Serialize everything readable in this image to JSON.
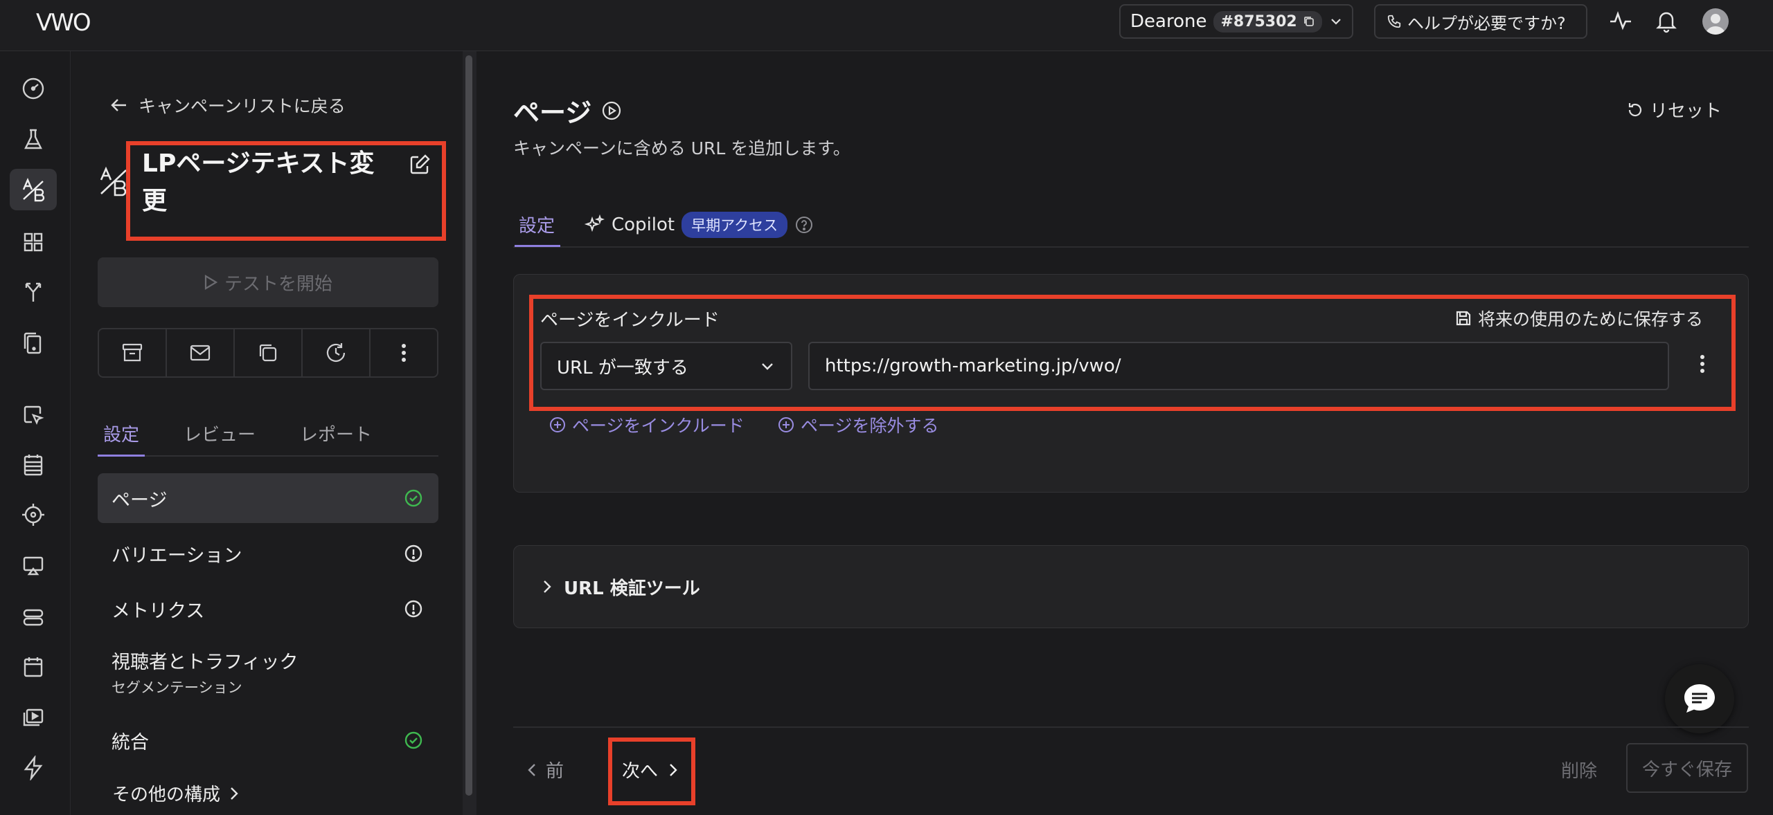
{
  "topbar": {
    "logo_text": "VWO",
    "account_name": "Dearone",
    "account_id": "#875302",
    "help_label": "ヘルプが必要ですか?"
  },
  "rail": {
    "icons": [
      "dashboard-icon",
      "flask-icon",
      "ab-test-icon",
      "grid-icon",
      "split-icon",
      "copy-device-icon",
      "cursor-icon",
      "list-icon",
      "target-icon",
      "presentation-icon",
      "server-icon",
      "calendar-icon",
      "video-icon",
      "bolt-icon"
    ]
  },
  "campaign": {
    "back_label": "キャンペーンリストに戻る",
    "title": "LPページテキスト変更",
    "start_label": "テストを開始",
    "action_icons": [
      "archive-icon",
      "mail-icon",
      "duplicate-icon",
      "schedule-icon",
      "more-icon"
    ],
    "tabs": [
      {
        "label": "設定",
        "active": true
      },
      {
        "label": "レビュー",
        "active": false
      },
      {
        "label": "レポート",
        "active": false
      }
    ],
    "nav": [
      {
        "label": "ページ",
        "status": "done"
      },
      {
        "label": "バリエーション",
        "status": "warning"
      },
      {
        "label": "メトリクス",
        "status": "warning"
      },
      {
        "label": "視聴者とトラフィック",
        "sub": "セグメンテーション",
        "status": "none"
      },
      {
        "label": "統合",
        "status": "done"
      }
    ],
    "more_label": "その他の構成"
  },
  "main": {
    "title": "ページ",
    "description": "キャンペーンに含める URL を追加します。",
    "reset_label": "リセット",
    "tabs": [
      {
        "label": "設定",
        "active": true
      },
      {
        "label": "Copilot",
        "badge": "早期アクセス",
        "active": false
      }
    ],
    "include": {
      "label": "ページをインクルード",
      "save_label": "将来の使用のために保存する",
      "match_type": "URL が一致する",
      "url_value": "https://growth-marketing.jp/vwo/"
    },
    "add_include_label": "ページをインクルード",
    "add_exclude_label": "ページを除外する",
    "url_tool_label": "URL 検証ツール",
    "prev_label": "前",
    "next_label": "次へ",
    "delete_label": "削除",
    "save_now_label": "今すぐ保存"
  },
  "colors": {
    "accent": "#8f7fe0",
    "highlight": "#e8402a",
    "success": "#3fb950",
    "badge_bg": "#2e3f9e"
  }
}
